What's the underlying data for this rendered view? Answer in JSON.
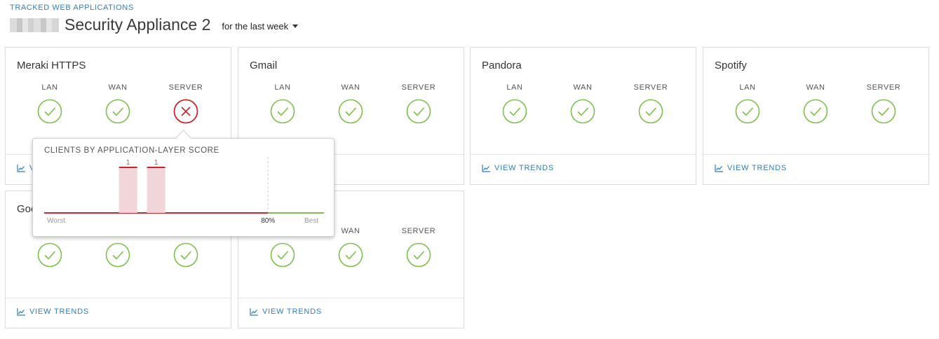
{
  "header": {
    "breadcrumb": "TRACKED WEB APPLICATIONS",
    "title": "Security Appliance 2",
    "period": "for the last week"
  },
  "columns": [
    "LAN",
    "WAN",
    "SERVER"
  ],
  "view_trends_label": "VIEW TRENDS",
  "cards": [
    {
      "title": "Meraki HTTPS",
      "status": {
        "lan": "ok",
        "wan": "ok",
        "server": "fail"
      }
    },
    {
      "title": "Gmail",
      "status": {
        "lan": "ok",
        "wan": "ok",
        "server": "ok"
      }
    },
    {
      "title": "Pandora",
      "status": {
        "lan": "ok",
        "wan": "ok",
        "server": "ok"
      }
    },
    {
      "title": "Spotify",
      "status": {
        "lan": "ok",
        "wan": "ok",
        "server": "ok"
      }
    },
    {
      "title": "Goo",
      "status": {
        "lan": "ok",
        "wan": "ok",
        "server": "ok"
      }
    },
    {
      "title": "",
      "status": {
        "lan": "ok",
        "wan": "ok",
        "server": "ok"
      }
    }
  ],
  "colors": {
    "ok": "#7cc04b",
    "fail": "#d0222b",
    "link": "#2f7ec2"
  },
  "popup": {
    "title": "CLIENTS BY APPLICATION-LAYER SCORE",
    "worst_label": "Worst",
    "best_label": "Best",
    "threshold_label": "80%",
    "chart_data": {
      "type": "bar",
      "x_range": [
        0,
        100
      ],
      "threshold": 80,
      "bars": [
        {
          "score": 30,
          "count": 1,
          "label": "1"
        },
        {
          "score": 40,
          "count": 1,
          "label": "1"
        }
      ]
    }
  }
}
